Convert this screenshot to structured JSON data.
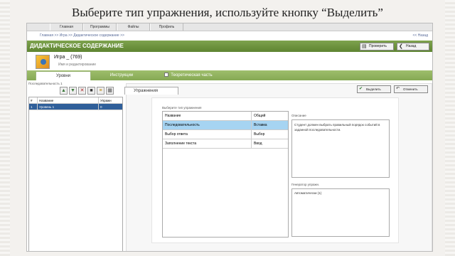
{
  "slide": {
    "title": "Выберите тип упражнения, используйте кнопку “Выделить”"
  },
  "menu": {
    "items": [
      "Главная",
      "Программы",
      "Файлы",
      "Профиль"
    ]
  },
  "breadcrumb": {
    "text": "Главная >> Игра >> Дидактическое содержание >>",
    "exit": "<< Назад"
  },
  "header": {
    "title": "ДИДАКТИЧЕСКОЕ СОДЕРЖАНИЕ",
    "preview_label": "Проверить",
    "back_label": "Назад"
  },
  "game": {
    "name": "Игра _ (769)",
    "subtitle": "Имя и редактирование"
  },
  "tabs": [
    {
      "label": "Уровни"
    },
    {
      "label": "Инструкции"
    },
    {
      "label": "Теоретическая часть"
    }
  ],
  "levels": {
    "label": "Последовательность 1",
    "columns": [
      "#",
      "Название",
      "Упражн"
    ],
    "rows": [
      {
        "num": "1",
        "name": "Уровень 1",
        "count": "0"
      }
    ]
  },
  "exercises": {
    "tab_label": "Упражнения",
    "select_label": "Выделить",
    "delete_label": "Отменить",
    "list_label": "Выберите тип упражнения",
    "columns": [
      "Название",
      "Общий"
    ],
    "rows": [
      {
        "name": "Последовательность",
        "type": "Вставка"
      },
      {
        "name": "Выбор ответа",
        "type": "Выбор"
      },
      {
        "name": "Заполнение текста",
        "type": "Ввод"
      }
    ],
    "description_label": "Описание",
    "description": "Студент должен выбрать правильный порядок событий в заданной последовательности.",
    "generator_label": "Генератор упражн.",
    "generator_value": "Автоматически (1)"
  }
}
